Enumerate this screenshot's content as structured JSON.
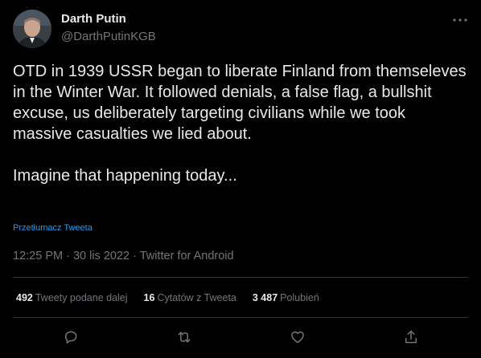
{
  "author": {
    "display_name": "Darth Putin",
    "handle": "@DarthPutinKGB"
  },
  "tweet": {
    "paragraphs": [
      "OTD in 1939 USSR began to liberate Finland from themseleves in the Winter War. It followed denials, a false flag, a bullshit excuse, us deliberately targeting civilians while we took massive casualties we lied about.",
      "Imagine that happening today..."
    ],
    "translate_link": "Przetłumacz Tweeta",
    "meta": "12:25 PM · 30 lis 2022 · Twitter for Android"
  },
  "stats": {
    "retweets": {
      "count": "492",
      "label": "Tweety podane dalej"
    },
    "quotes": {
      "count": "16",
      "label": "Cytatów z Tweeta"
    },
    "likes": {
      "count": "3 487",
      "label": "Polubień"
    }
  },
  "icons": {
    "more": "more-icon",
    "reply": "reply-icon",
    "retweet": "retweet-icon",
    "like": "heart-icon",
    "share": "share-icon"
  },
  "colors": {
    "background": "#000000",
    "text": "#e7e9ea",
    "secondary": "#71767b",
    "link": "#1d9bf0",
    "divider": "#2f3336"
  }
}
